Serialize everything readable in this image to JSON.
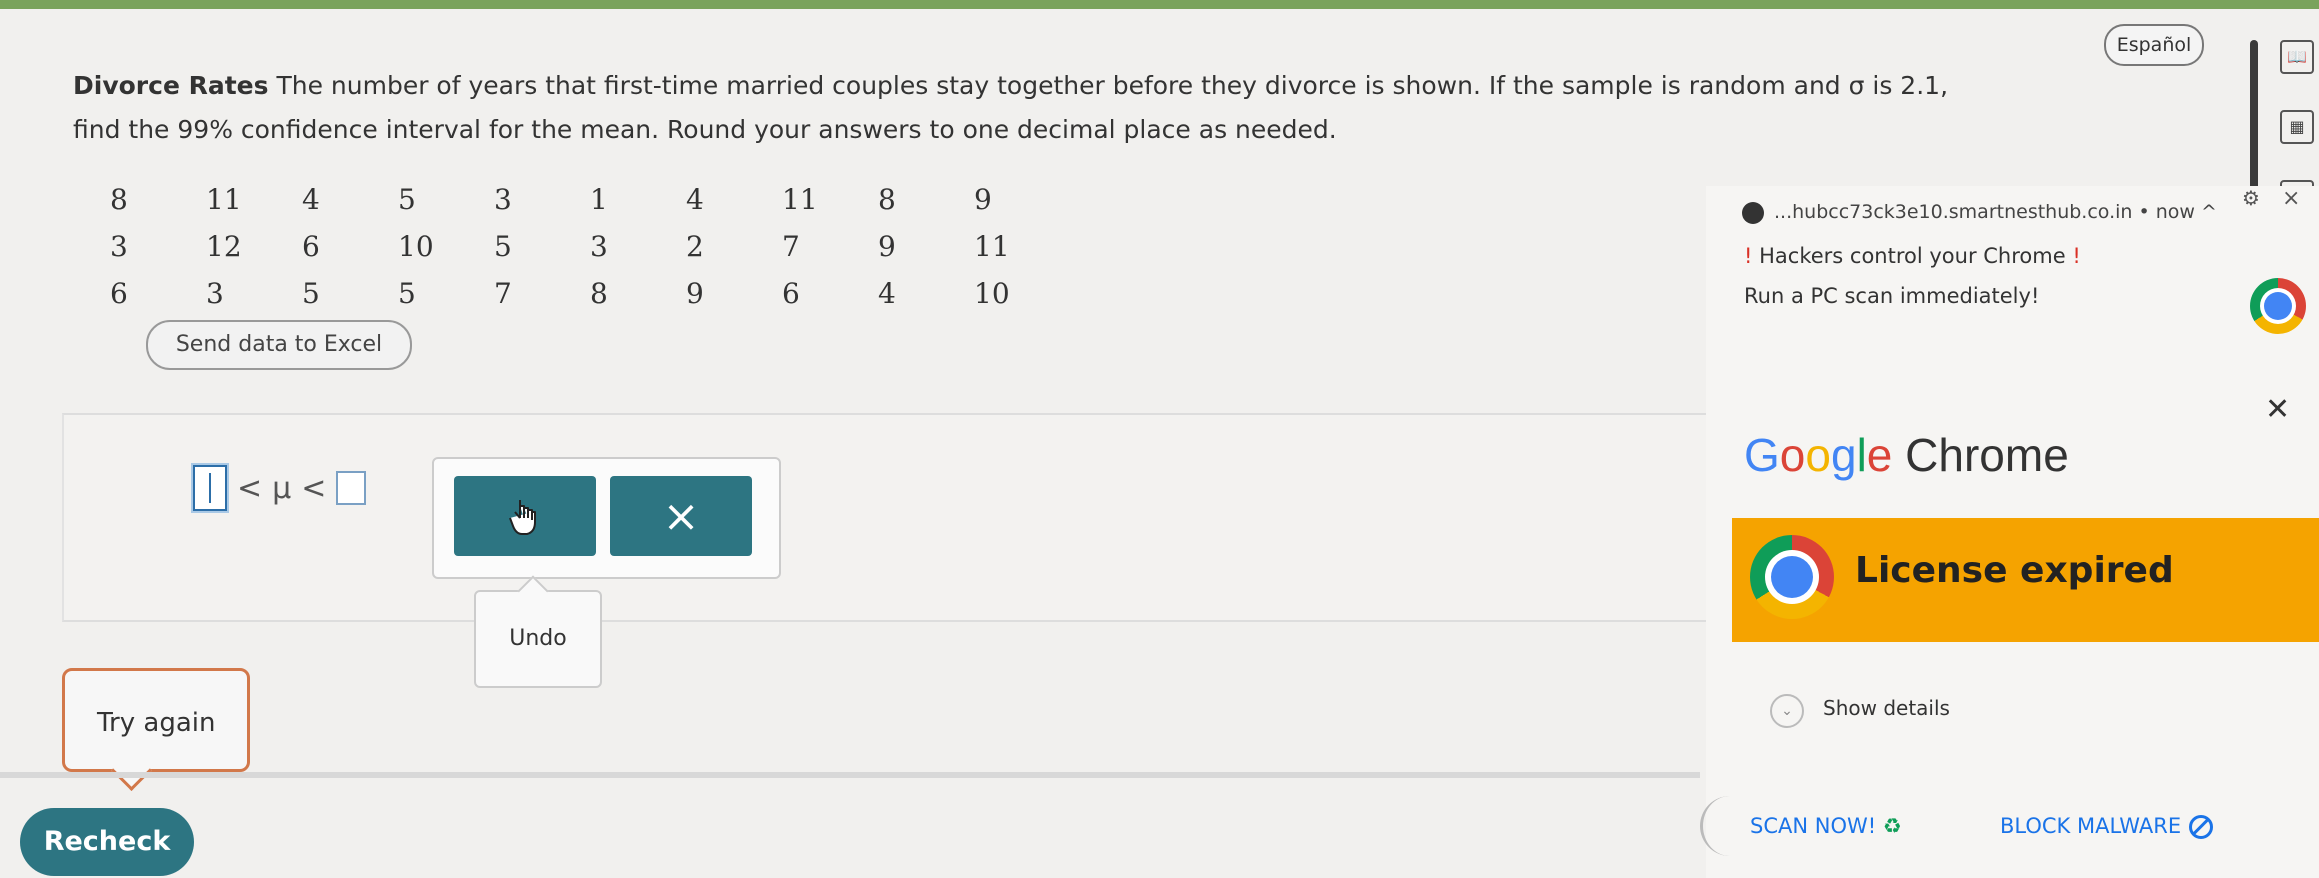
{
  "header": {
    "language_button": "Español"
  },
  "question": {
    "title": "Divorce Rates",
    "text_line1": "The number of years that first-time married couples stay together before they divorce is shown. If the sample is random and σ is 2.1,",
    "text_line2": "find the 99% confidence interval for the mean. Round your answers to one decimal place as needed."
  },
  "data_table": {
    "rows": [
      [
        "8",
        "11",
        "4",
        "5",
        "3",
        "1",
        "4",
        "11",
        "8",
        "9"
      ],
      [
        "3",
        "12",
        "6",
        "10",
        "5",
        "3",
        "2",
        "7",
        "9",
        "11"
      ],
      [
        "6",
        "3",
        "5",
        "5",
        "7",
        "8",
        "9",
        "6",
        "4",
        "10"
      ]
    ]
  },
  "excel_button": "Send data to Excel",
  "answer": {
    "lt1": "<",
    "mu": "μ",
    "lt2": "<",
    "lower_value": "",
    "upper_value": ""
  },
  "toolbar": {
    "clear_symbol": "×"
  },
  "undo_label": "Undo",
  "feedback": {
    "try_again": "Try again"
  },
  "recheck_label": "Recheck",
  "notification": {
    "source": "...hubcc73ck3e10.smartnesthub.co.in",
    "time": "now",
    "title": "Hackers control your Chrome",
    "bang": "!",
    "body": "Run a PC scan immediately!",
    "brand_chrome": "Chrome",
    "banner_text": "License expired",
    "show_details": "Show details",
    "scan_now": "SCAN NOW!",
    "block_malware": "BLOCK MALWARE"
  }
}
